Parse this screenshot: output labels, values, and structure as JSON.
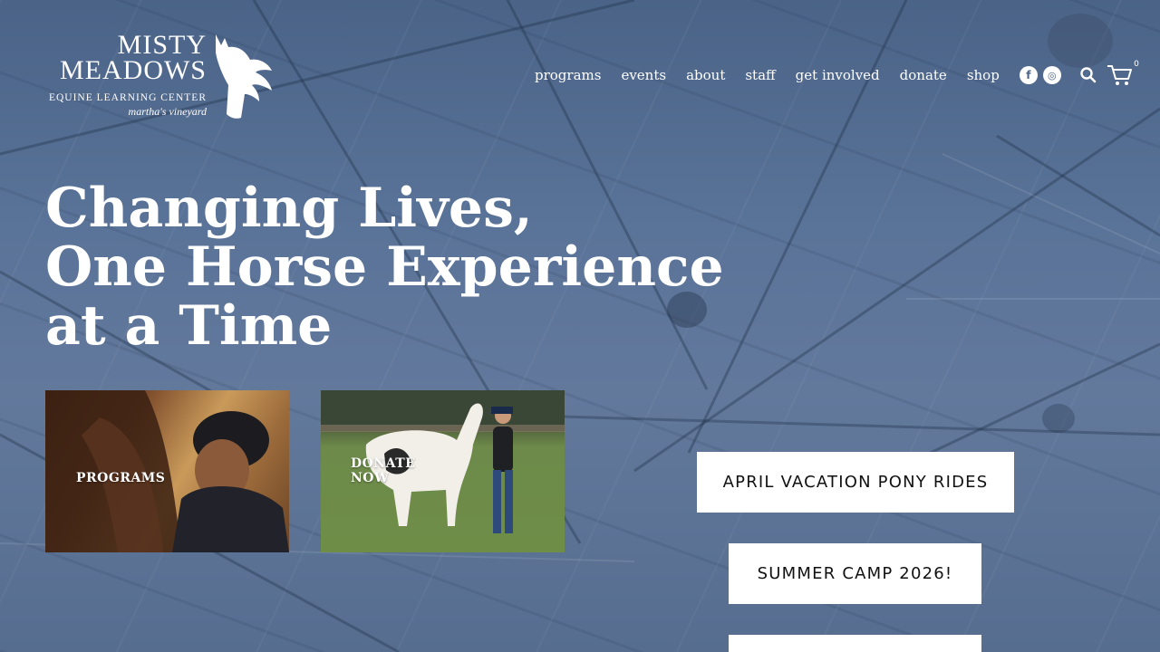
{
  "logo": {
    "line1": "MISTY",
    "line2": "MEADOWS",
    "line3": "EQUINE LEARNING CENTER",
    "line4": "martha's vineyard"
  },
  "nav": {
    "items": [
      "programs",
      "events",
      "about",
      "staff",
      "get involved",
      "donate",
      "shop"
    ]
  },
  "social": {
    "facebook": "f",
    "instagram": "◎"
  },
  "cart": {
    "count": "0"
  },
  "hero": {
    "line1": "Changing Lives,",
    "line2": "One Horse Experience",
    "line3": "at a Time"
  },
  "tiles": {
    "programs": "PROGRAMS",
    "donate_line1": "DONATE",
    "donate_line2": "NOW"
  },
  "buttons": {
    "april": "APRIL VACATION PONY RIDES",
    "camp": "SUMMER CAMP 2026!",
    "third": ""
  },
  "colors": {
    "background": "#56709a",
    "text": "#ffffff",
    "button_bg": "#ffffff",
    "button_text": "#111111"
  }
}
